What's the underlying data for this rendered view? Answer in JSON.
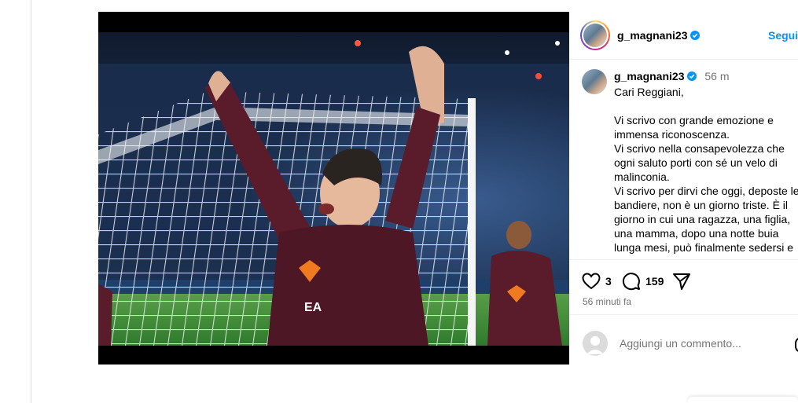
{
  "post": {
    "username": "g_magnani23",
    "follow_label": "Segui",
    "time_ago": "56 m",
    "caption_greeting": "Cari Reggiani,",
    "caption_text": "Vi scrivo con grande emozione e immensa riconoscenza.\nVi scrivo nella consapevolezza che ogni saluto porti con sé un velo di malinconia.\nVi scrivo per dirvi che oggi, deposte le bandiere, non è un giorno triste. È il giorno in cui una ragazza, una figlia, una mamma, dopo una notte buia lunga mesi, può finalmente sedersi e",
    "likes_count": "3",
    "comments_count": "159",
    "posted_label": "56 minuti fa",
    "comment_placeholder": "Aggiungi un commento...",
    "photo_description": "",
    "photo_sponsor_text": "EA"
  },
  "icons": {
    "verified": "verified-badge-icon",
    "like": "heart-icon",
    "comment": "comment-bubble-icon",
    "share": "paper-plane-icon"
  },
  "colors": {
    "accent": "#0095f6",
    "jersey": "#5a1b2b",
    "pitch": "#3e8a3a",
    "stands": "#1b2a4a"
  }
}
